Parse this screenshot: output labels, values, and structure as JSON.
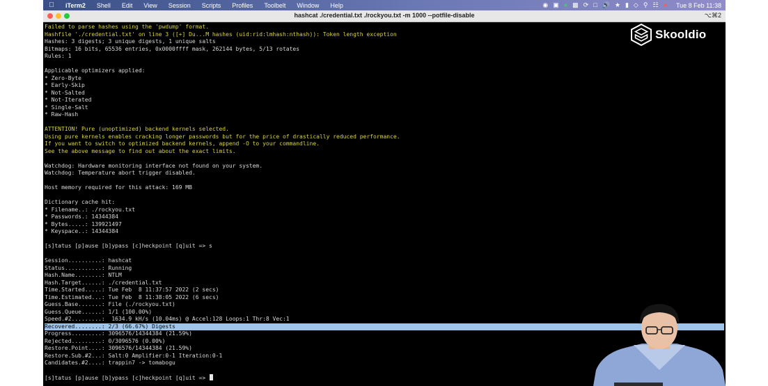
{
  "menubar": {
    "app_name": "iTerm2",
    "menus": [
      "Shell",
      "Edit",
      "View",
      "Session",
      "Scripts",
      "Profiles",
      "Toolbelt",
      "Window",
      "Help"
    ],
    "clock": "Tue 8 Feb  11:38"
  },
  "window": {
    "title": "hashcat ./credential.txt ./rockyou.txt -m 1000 --potfile-disable",
    "shortcut": "⌥⌘2"
  },
  "logo": {
    "text": "Skooldio"
  },
  "terminal": {
    "highlight_color": "#9fc6ea",
    "warning_color": "#d7d340",
    "lines": [
      {
        "text": "Failed to parse hashes using the 'pwdump' format.",
        "style": "y"
      },
      {
        "text": "Hashfile './credential.txt' on line 3 ([+] Du...M hashes (uid:rid:lmhash:nthash)): Token length exception",
        "style": "y"
      },
      {
        "text": "Hashes: 3 digests; 3 unique digests, 1 unique salts",
        "style": ""
      },
      {
        "text": "Bitmaps: 16 bits, 65536 entries, 0x0000ffff mask, 262144 bytes, 5/13 rotates",
        "style": ""
      },
      {
        "text": "Rules: 1",
        "style": ""
      },
      {
        "text": "",
        "style": ""
      },
      {
        "text": "Applicable optimizers applied:",
        "style": ""
      },
      {
        "text": "* Zero-Byte",
        "style": ""
      },
      {
        "text": "* Early-Skip",
        "style": ""
      },
      {
        "text": "* Not-Salted",
        "style": ""
      },
      {
        "text": "* Not-Iterated",
        "style": ""
      },
      {
        "text": "* Single-Salt",
        "style": ""
      },
      {
        "text": "* Raw-Hash",
        "style": ""
      },
      {
        "text": "",
        "style": ""
      },
      {
        "text": "ATTENTION! Pure (unoptimized) backend kernels selected.",
        "style": "y"
      },
      {
        "text": "Using pure kernels enables cracking longer passwords but for the price of drastically reduced performance.",
        "style": "y"
      },
      {
        "text": "If you want to switch to optimized backend kernels, append -O to your commandline.",
        "style": "y"
      },
      {
        "text": "See the above message to find out about the exact limits.",
        "style": "y"
      },
      {
        "text": "",
        "style": ""
      },
      {
        "text": "Watchdog: Hardware monitoring interface not found on your system.",
        "style": ""
      },
      {
        "text": "Watchdog: Temperature abort trigger disabled.",
        "style": ""
      },
      {
        "text": "",
        "style": ""
      },
      {
        "text": "Host memory required for this attack: 169 MB",
        "style": ""
      },
      {
        "text": "",
        "style": ""
      },
      {
        "text": "Dictionary cache hit:",
        "style": ""
      },
      {
        "text": "* Filename..: ./rockyou.txt",
        "style": ""
      },
      {
        "text": "* Passwords.: 14344384",
        "style": ""
      },
      {
        "text": "* Bytes.....: 139921497",
        "style": ""
      },
      {
        "text": "* Keyspace..: 14344384",
        "style": ""
      },
      {
        "text": "",
        "style": ""
      },
      {
        "text": "[s]tatus [p]ause [b]ypass [c]heckpoint [q]uit => s",
        "style": ""
      },
      {
        "text": "",
        "style": ""
      },
      {
        "text": "Session..........: hashcat",
        "style": ""
      },
      {
        "text": "Status...........: Running",
        "style": ""
      },
      {
        "text": "Hash.Name........: NTLM",
        "style": ""
      },
      {
        "text": "Hash.Target......: ./credential.txt",
        "style": ""
      },
      {
        "text": "Time.Started.....: Tue Feb  8 11:37:57 2022 (2 secs)",
        "style": ""
      },
      {
        "text": "Time.Estimated...: Tue Feb  8 11:38:05 2022 (6 secs)",
        "style": ""
      },
      {
        "text": "Guess.Base.......: File (./rockyou.txt)",
        "style": ""
      },
      {
        "text": "Guess.Queue......: 1/1 (100.00%)",
        "style": ""
      },
      {
        "text": "Speed.#2.........:  1634.9 kH/s (10.04ms) @ Accel:128 Loops:1 Thr:8 Vec:1",
        "style": ""
      },
      {
        "text": "Recovered........: 2/3 (66.67%) Digests",
        "style": "hl"
      },
      {
        "text": "Progress.........: 3096576/14344384 (21.59%)",
        "style": ""
      },
      {
        "text": "Rejected.........: 0/3096576 (0.00%)",
        "style": ""
      },
      {
        "text": "Restore.Point....: 3096576/14344384 (21.59%)",
        "style": ""
      },
      {
        "text": "Restore.Sub.#2...: Salt:0 Amplifier:0-1 Iteration:0-1",
        "style": ""
      },
      {
        "text": "Candidates.#2....: trappin7 -> tomabogu",
        "style": ""
      },
      {
        "text": "",
        "style": ""
      },
      {
        "text": "[s]tatus [p]ause [b]ypass [c]heckpoint [q]uit => ",
        "style": "",
        "cursor": true
      }
    ]
  }
}
